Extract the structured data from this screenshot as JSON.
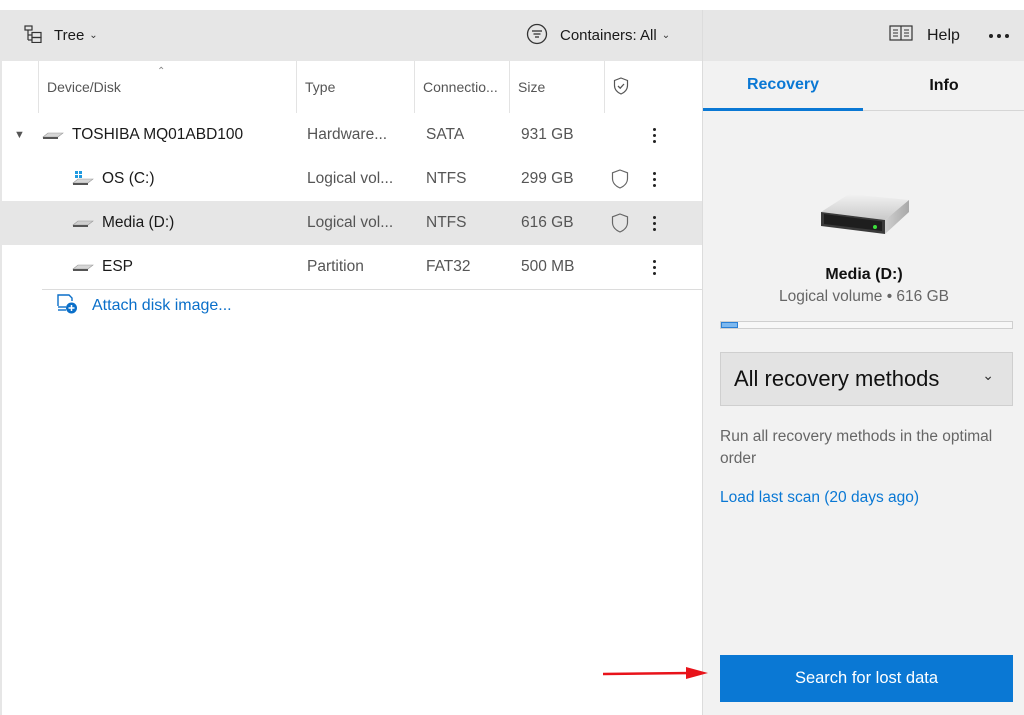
{
  "toolbar": {
    "view_icon": "tree-view-icon",
    "view_label": "Tree",
    "filter_icon": "filter-icon",
    "filter_label": "Containers: All",
    "help_icon": "book-icon",
    "help_label": "Help",
    "more_icon": "more-horizontal-icon"
  },
  "columns": [
    {
      "label": "Device/Disk",
      "sorted": "ascending"
    },
    {
      "label": "Type"
    },
    {
      "label": "Connectio..."
    },
    {
      "label": "Size"
    },
    {
      "label": "",
      "icon": "shield-check-icon"
    }
  ],
  "rows": [
    {
      "name": "TOSHIBA MQ01ABD100",
      "type": "Hardware...",
      "connection": "SATA",
      "size": "931 GB",
      "protected": false,
      "icon": "hard-drive-icon",
      "expanded": true,
      "level": 0,
      "selected": false
    },
    {
      "name": "OS (C:)",
      "type": "Logical vol...",
      "connection": "NTFS",
      "size": "299 GB",
      "protected": true,
      "icon": "windows-drive-icon",
      "level": 1,
      "selected": false
    },
    {
      "name": "Media (D:)",
      "type": "Logical vol...",
      "connection": "NTFS",
      "size": "616 GB",
      "protected": true,
      "icon": "drive-icon",
      "level": 1,
      "selected": true
    },
    {
      "name": "ESP",
      "type": "Partition",
      "connection": "FAT32",
      "size": "500 MB",
      "protected": false,
      "icon": "drive-icon",
      "level": 1,
      "selected": false
    }
  ],
  "attach_label": "Attach disk image...",
  "panel": {
    "tabs": [
      {
        "label": "Recovery",
        "active": true
      },
      {
        "label": "Info",
        "active": false
      }
    ],
    "drive_name": "Media (D:)",
    "drive_sub": "Logical volume • 616 GB",
    "usage_percent": 6,
    "method_selected": "All recovery methods",
    "method_description": "Run all recovery methods in the optimal order",
    "load_scan_label": "Load last scan (20 days ago)",
    "search_button_label": "Search for lost data"
  },
  "colors": {
    "accent": "#0a78d4",
    "link": "#0a6fc9",
    "annotation_arrow": "#e8131a",
    "selected_row": "#e6e6e6"
  }
}
